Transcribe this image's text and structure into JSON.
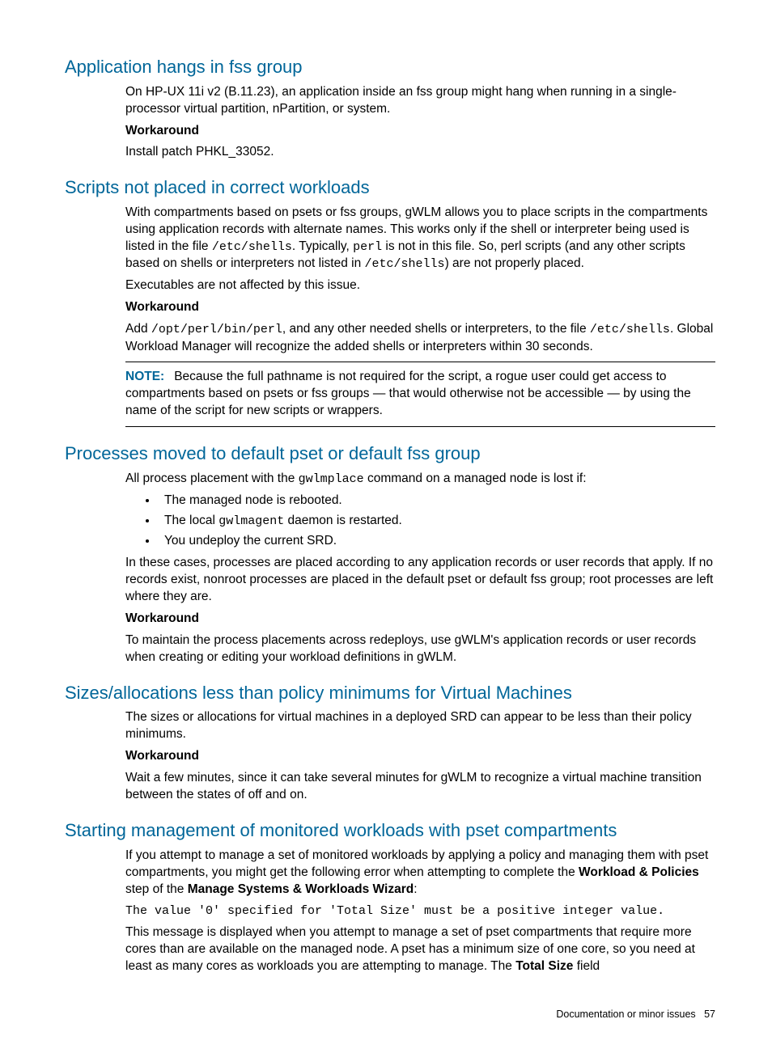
{
  "s1": {
    "title": "Application hangs in fss group",
    "p1": "On HP-UX 11i v2 (B.11.23), an application inside an fss group might hang when running in a single-processor virtual partition, nPartition, or system.",
    "wa_label": "Workaround",
    "wa_text": "Install patch PHKL_33052."
  },
  "s2": {
    "title": "Scripts not placed in correct workloads",
    "p1a": "With compartments based on psets or fss groups, gWLM allows you to place scripts in the compartments using application records with alternate names. This works only if the shell or interpreter being used is listed in the file ",
    "c1": "/etc/shells",
    "p1b": ". Typically, ",
    "c2": "perl",
    "p1c": " is not in this file. So, perl scripts (and any other scripts based on shells or interpreters not listed in ",
    "c3": "/etc/shells",
    "p1d": ") are not properly placed.",
    "p2": "Executables are not affected by this issue.",
    "wa_label": "Workaround",
    "wa_a": "Add ",
    "wa_c1": "/opt/perl/bin/perl",
    "wa_b": ", and any other needed shells or interpreters, to the file ",
    "wa_c2": "/etc/shells",
    "wa_c": ". Global Workload Manager will recognize the added shells or interpreters within 30 seconds.",
    "note_label": "NOTE:",
    "note_text": "Because the full pathname is not required for the script, a rogue user could get access to compartments based on psets or fss groups — that would otherwise not be accessible — by using the name of the script for new scripts or wrappers."
  },
  "s3": {
    "title": "Processes moved to default pset or default fss group",
    "p1a": "All process placement with the ",
    "c1": "gwlmplace",
    "p1b": " command on a managed node is lost if:",
    "li1": "The managed node is rebooted.",
    "li2a": "The local ",
    "li2c": "gwlmagent",
    "li2b": " daemon is restarted.",
    "li3": "You undeploy the current SRD.",
    "p2": "In these cases, processes are placed according to any application records or user records that apply. If no records exist, nonroot processes are placed in the default pset or default fss group; root processes are left where they are.",
    "wa_label": "Workaround",
    "wa_text": "To maintain the process placements across redeploys, use gWLM's application records or user records when creating or editing your workload definitions in gWLM."
  },
  "s4": {
    "title": "Sizes/allocations less than policy minimums for Virtual Machines",
    "p1": "The sizes or allocations for virtual machines in a deployed SRD can appear to be less than their policy minimums.",
    "wa_label": "Workaround",
    "wa_text": "Wait a few minutes, since it can take several minutes for gWLM to recognize a virtual machine transition between the states of off and on."
  },
  "s5": {
    "title": "Starting management of monitored workloads with pset compartments",
    "p1a": "If you attempt to manage a set of monitored workloads by applying a policy and managing them with pset compartments, you might get the following error when attempting to complete the ",
    "b1": "Workload & Policies",
    "p1b": " step of the ",
    "b2": "Manage Systems & Workloads Wizard",
    "p1c": ":",
    "code": "The value '0' specified for 'Total Size' must be a positive integer value.",
    "p2a": "This message is displayed when you attempt to manage a set of pset compartments that require more cores than are available on the managed node. A pset has a minimum size of one core, so you need at least as many cores as workloads you are attempting to manage. The ",
    "b3": "Total Size",
    "p2b": " field"
  },
  "footer": {
    "text": "Documentation or minor issues",
    "page": "57"
  }
}
